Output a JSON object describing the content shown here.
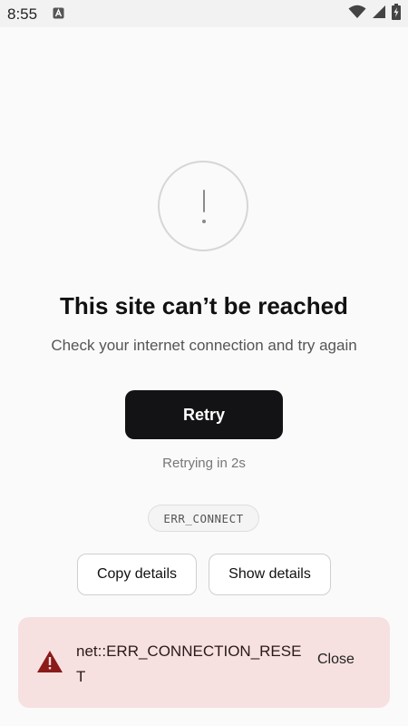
{
  "status_bar": {
    "time": "8:55",
    "icons": [
      "notification-a-icon",
      "wifi-icon",
      "signal-icon",
      "battery-charging-icon"
    ]
  },
  "error_page": {
    "icon": "exclamation-circle-icon",
    "title": "This site can’t be reached",
    "subtitle": "Check your internet connection and try again",
    "retry_label": "Retry",
    "retrying_text": "Retrying in 2s",
    "error_code": "ERR_CONNECT",
    "copy_details_label": "Copy details",
    "show_details_label": "Show details"
  },
  "snackbar": {
    "icon": "warning-triangle-icon",
    "message": "net::ERR_CONNECTION_RESET",
    "close_label": "Close"
  },
  "colors": {
    "background": "#fafafa",
    "primary_button": "#131315",
    "snackbar_bg": "#f7e0e0",
    "warning_icon": "#8b1a1a"
  }
}
